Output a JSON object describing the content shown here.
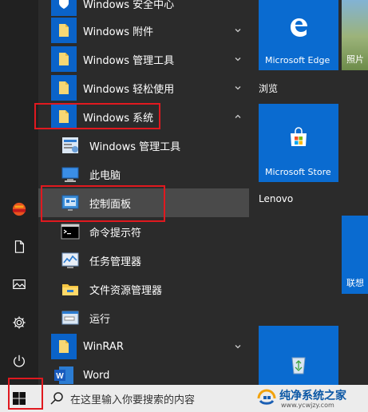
{
  "start_menu": {
    "apps": [
      {
        "label": "Windows 安全中心",
        "icon": "shield-icon",
        "expandable": false
      },
      {
        "label": "Windows 附件",
        "icon": "folder-icon",
        "expandable": true,
        "expanded": false
      },
      {
        "label": "Windows 管理工具",
        "icon": "folder-icon",
        "expandable": true,
        "expanded": false
      },
      {
        "label": "Windows 轻松使用",
        "icon": "folder-icon",
        "expandable": true,
        "expanded": false
      },
      {
        "label": "Windows 系统",
        "icon": "folder-icon",
        "expandable": true,
        "expanded": true
      },
      {
        "label": "Windows 管理工具",
        "icon": "admin-tools-icon",
        "child": true
      },
      {
        "label": "此电脑",
        "icon": "computer-icon",
        "child": true
      },
      {
        "label": "控制面板",
        "icon": "control-panel-icon",
        "child": true,
        "selected": true
      },
      {
        "label": "命令提示符",
        "icon": "command-prompt-icon",
        "child": true
      },
      {
        "label": "任务管理器",
        "icon": "task-manager-icon",
        "child": true
      },
      {
        "label": "文件资源管理器",
        "icon": "file-explorer-icon",
        "child": true
      },
      {
        "label": "运行",
        "icon": "run-icon",
        "child": true
      },
      {
        "label": "WinRAR",
        "icon": "folder-icon",
        "expandable": true,
        "expanded": false
      },
      {
        "label": "Word",
        "icon": "word-icon",
        "expandable": false
      }
    ],
    "rail": [
      {
        "name": "user-avatar",
        "icon": "avatar-icon"
      },
      {
        "name": "documents",
        "icon": "document-icon"
      },
      {
        "name": "pictures",
        "icon": "pictures-icon"
      },
      {
        "name": "settings",
        "icon": "gear-icon"
      },
      {
        "name": "power",
        "icon": "power-icon"
      }
    ],
    "tiles": {
      "edge_label": "Microsoft Edge",
      "photos_label": "照片",
      "browse_group": "浏览",
      "store_label": "Microsoft Store",
      "lenovo_group": "Lenovo",
      "lenovo_tile_label": "联想"
    }
  },
  "taskbar": {
    "search_placeholder": "在这里输入你要搜索的内容"
  },
  "watermark": {
    "title": "纯净系统之家",
    "url": "www.ycwjzy.com"
  },
  "colors": {
    "accent": "#0a6bd0",
    "highlight_box": "#e0191f",
    "menu_bg": "#2b2b2b",
    "taskbar_bg": "#ececec"
  }
}
